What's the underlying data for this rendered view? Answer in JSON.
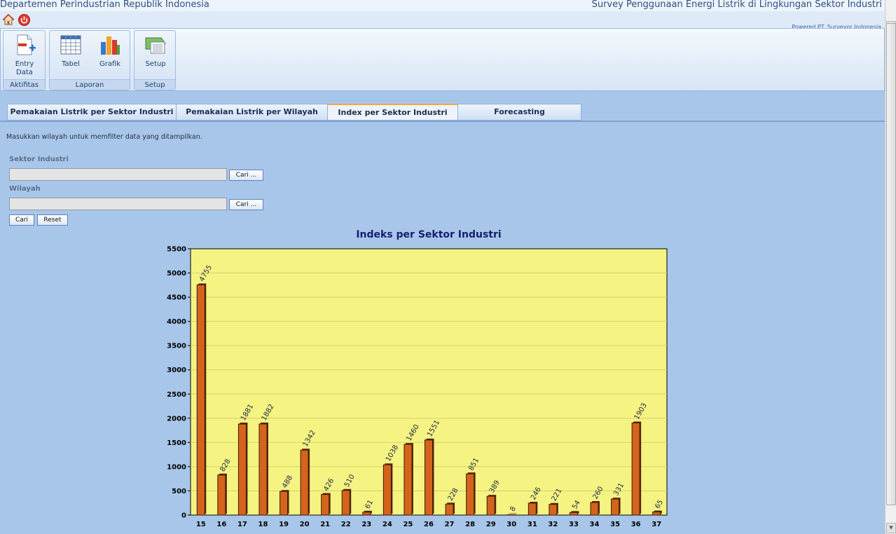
{
  "header": {
    "app_title": "Departemen Perindustrian Republik Indonesia",
    "app_subtitle": "Survey Penggunaan Energi Listrik di Lingkungan Sektor Industri",
    "powered_by": "Powered PT. Surveyor Indonesia"
  },
  "quickbar": {
    "icons": [
      "home-icon",
      "power-icon"
    ]
  },
  "ribbon": {
    "groups": [
      {
        "label": "Aktifitas",
        "buttons": [
          {
            "label": "Entry Data",
            "icon": "entry-data-icon"
          }
        ]
      },
      {
        "label": "Laporan",
        "buttons": [
          {
            "label": "Tabel",
            "icon": "table-icon"
          },
          {
            "label": "Grafik",
            "icon": "bar-chart-icon"
          }
        ]
      },
      {
        "label": "Setup",
        "buttons": [
          {
            "label": "Setup",
            "icon": "setup-icon"
          }
        ]
      }
    ]
  },
  "tabs": [
    {
      "label": "Pemakaian Listrik per Sektor Industri",
      "active": false
    },
    {
      "label": "Pemakaian Listrik per Wilayah",
      "active": false
    },
    {
      "label": "Index per Sektor Industri",
      "active": true
    },
    {
      "label": "Forecasting",
      "active": false
    }
  ],
  "filter": {
    "intro": "Masukkan wilayah untuk memfilter data yang ditampilkan.",
    "sektor_label": "Sektor Industri",
    "sektor_value": "",
    "sektor_search_label": "Cari ...",
    "wilayah_label": "Wilayah",
    "wilayah_value": "",
    "wilayah_search_label": "Cari ...",
    "search_label": "Cari",
    "reset_label": "Reset"
  },
  "colors": {
    "page_bg": "#a8c6ea",
    "plot_bg": "#f5f382",
    "bar_fill": "#d4641c",
    "title_color": "#14206e",
    "active_tab_accent": "#f2a64c"
  },
  "chart_data": {
    "type": "bar",
    "title": "Indeks per Sektor Industri",
    "xlabel": "",
    "ylabel": "",
    "ylim": [
      0,
      5500
    ],
    "yticks": [
      0,
      500,
      1000,
      1500,
      2000,
      2500,
      3000,
      3500,
      4000,
      4500,
      5000,
      5500
    ],
    "grid": true,
    "categories": [
      "15",
      "16",
      "17",
      "18",
      "19",
      "20",
      "21",
      "22",
      "23",
      "24",
      "25",
      "26",
      "27",
      "28",
      "29",
      "30",
      "31",
      "32",
      "33",
      "34",
      "35",
      "36",
      "37"
    ],
    "values": [
      4755,
      828,
      1881,
      1882,
      488,
      1342,
      426,
      510,
      61,
      1038,
      1460,
      1551,
      228,
      851,
      389,
      8,
      246,
      221,
      54,
      260,
      331,
      1903,
      65
    ],
    "data_labels": [
      "4755",
      "828",
      "1881",
      "1882",
      "488",
      "1342",
      "426",
      "510",
      "61",
      "1038",
      "1460",
      "1551",
      "228",
      "851",
      "389",
      "8",
      "246",
      "221",
      "54",
      "260",
      "331",
      "1903",
      "65"
    ]
  }
}
